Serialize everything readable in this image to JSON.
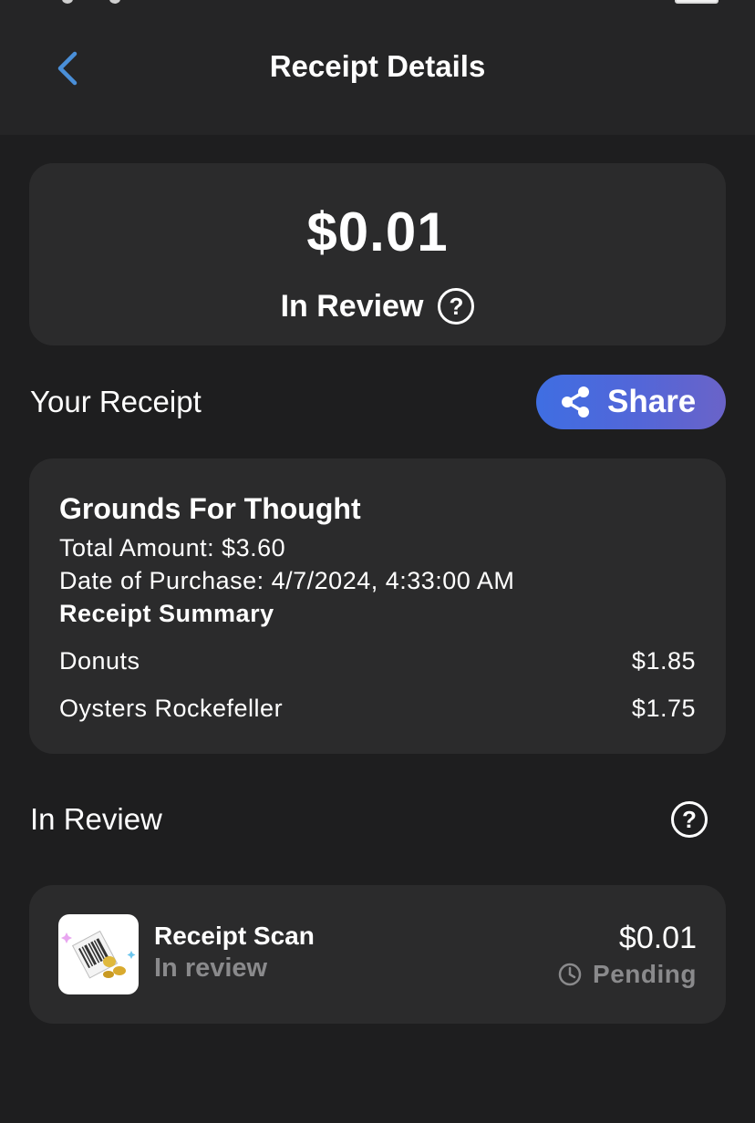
{
  "header": {
    "title": "Receipt Details"
  },
  "summary": {
    "amount": "$0.01",
    "status": "In Review"
  },
  "receipt_section": {
    "title": "Your Receipt",
    "share_label": "Share",
    "merchant": "Grounds For Thought",
    "total_amount": "Total Amount: $3.60",
    "date_of_purchase": "Date of Purchase: 4/7/2024, 4:33:00 AM",
    "summary_label": "Receipt Summary",
    "items": [
      {
        "name": "Donuts",
        "price": "$1.85"
      },
      {
        "name": "Oysters Rockefeller",
        "price": "$1.75"
      }
    ]
  },
  "review_section": {
    "title": "In Review",
    "entry": {
      "title": "Receipt Scan",
      "subtitle": "In review",
      "amount": "$0.01",
      "status": "Pending"
    }
  },
  "icons": {
    "back": "chevron-left-icon",
    "help": "question-circle-icon",
    "share": "share-icon",
    "clock": "clock-icon",
    "thumbnail": "receipt-scan-illustration"
  },
  "colors": {
    "background": "#1e1e1f",
    "card": "#2b2b2c",
    "accent_blue": "#4a8fd8",
    "share_gradient_start": "#3f6ee2",
    "share_gradient_end": "#6a63c8",
    "muted_text": "#8a8a8c"
  }
}
